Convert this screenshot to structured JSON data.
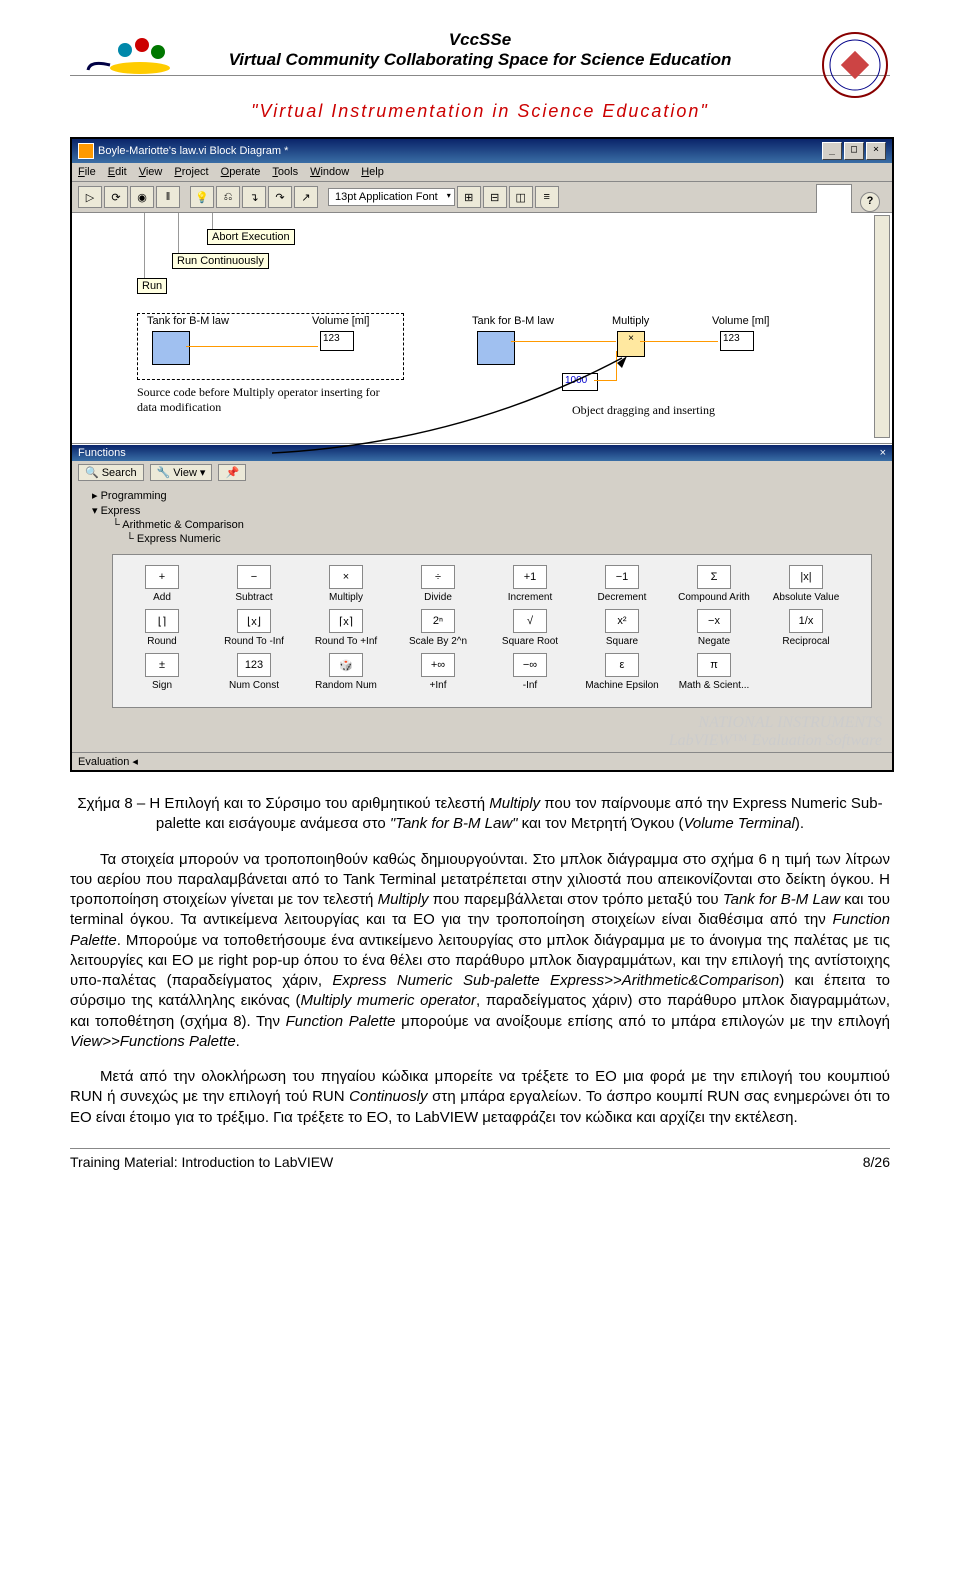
{
  "header": {
    "title1": "VccSSe",
    "title2": "Virtual Community Collaborating Space for Science Education",
    "subtitle": "\"Virtual Instrumentation in Science Education\""
  },
  "window": {
    "title": "Boyle-Mariotte's law.vi Block Diagram *",
    "menu": [
      "File",
      "Edit",
      "View",
      "Project",
      "Operate",
      "Tools",
      "Window",
      "Help"
    ],
    "font": "13pt Application Font",
    "tooltip_run": "Run",
    "tooltip_run_cont": "Run Continuously",
    "tooltip_abort": "Abort Execution",
    "labels": {
      "tank1": "Tank for B-M law",
      "volume1": "Volume [ml]",
      "tank2": "Tank for B-M law",
      "multiply": "Multiply",
      "volume2": "Volume [ml]",
      "num1": "123",
      "num2": "123",
      "const1000": "1000"
    },
    "caption_left": "Source code before Multiply operator inserting for data modification",
    "caption_right": "Object dragging and inserting"
  },
  "functions": {
    "title": "Functions",
    "search": "Search",
    "view": "View",
    "tree": {
      "programming": "Programming",
      "express": "Express",
      "arith": "Arithmetic & Comparison",
      "expnum": "Express Numeric"
    },
    "palette": [
      [
        "Add",
        "Subtract",
        "Multiply",
        "Divide",
        "Increment",
        "Decrement",
        "Compound Arith",
        "Absolute Value"
      ],
      [
        "Round",
        "Round To -Inf",
        "Round To +Inf",
        "Scale By 2^n",
        "Square Root",
        "Square",
        "Negate",
        "Reciprocal"
      ],
      [
        "Sign",
        "Num Const",
        "Random Num",
        "+Inf",
        "-Inf",
        "Machine Epsilon",
        "Math & Scient...",
        ""
      ]
    ],
    "palette_icons": [
      [
        "+",
        "−",
        "×",
        "÷",
        "+1",
        "−1",
        "Σ",
        "|x|"
      ],
      [
        "⌊⌉",
        "⌊x⌋",
        "⌈x⌉",
        "2ⁿ",
        "√",
        "x²",
        "−x",
        "1/x"
      ],
      [
        "±",
        "123",
        "🎲",
        "+∞",
        "−∞",
        "ε",
        "π",
        ""
      ]
    ]
  },
  "watermark1": "NATIONAL INSTRUMENTS",
  "watermark2": "LabVIEW™ Evaluation Software",
  "statusbar": "Evaluation",
  "body": {
    "caption": "Σχήμα 8 – Η Επιλογή και το Σύρσιμο  του αριθμητικού τελεστή ",
    "caption_it1": "Multiply",
    "caption2": " που τον παίρνουμε από την Express Numeric Sub-palette και εισάγουμε  ανάμεσα στο ",
    "caption_it2": "\"Tank for B-M Law\"",
    "caption3": " και τον Μετρητή Όγκου (",
    "caption_it3": "Volume Terminal",
    "caption4": ").",
    "p2a": "Τα στοιχεία μπορούν να τροποποιηθούν καθώς δημιουργούνται. Στο μπλοκ διάγραμμα  στο σχήμα 6 η τιμή  των λίτρων του αερίου που παραλαμβάνεται από το  Tank Terminal μετατρέπεται στην χιλιοστά που απεικονίζονται στο δείκτη όγκου. Η τροποποίηση στοιχείων γίνεται με τον τελεστή  ",
    "p2it1": "Multiply",
    "p2b": "  που παρεμβάλλεται στον τρόπο μεταξύ  του ",
    "p2it2": "Tank for B-M Law",
    "p2c": "   και του   terminal όγκου. Τα αντικείμενα λειτουργίας και τα EO για την τροποποίηση στοιχείων είναι διαθέσιμα από την  ",
    "p2it3": "Function Palette",
    "p2d": ".  Μπορούμε να τοποθετήσουμε ένα αντικείμενο λειτουργίας στο μπλοκ διάγραμμα  με το άνοιγμα της παλέτας με τις λειτουργίες και EO  με right pop-up όπου το ένα θέλει στο παράθυρο μπλοκ διαγραμμάτων, και την επιλογή της αντίστοιχης υπο-παλέτας (παραδείγματος χάριν, ",
    "p2it4": "Express Numeric Sub-palette Express>>Arithmetic&Comparison",
    "p2e": ") και έπειτα το σύρσιμο της κατάλληλης εικόνας (",
    "p2it5": "Multiply mumeric operator",
    "p2f": ", παραδείγματος χάριν) στο παράθυρο μπλοκ διαγραμμάτων, και τοποθέτηση (σχήμα 8). Την  ",
    "p2it6": "Function Palette",
    "p2g": "  μπορούμε να ανοίξουμε επίσης από το μπάρα επιλογών με την επιλογή  ",
    "p2it7": "View>>Functions Palette",
    "p2h": ".",
    "p3a": "Μετά από την ολοκλήρωση του πηγαίου κώδικα μπορείτε να τρέξετε το EO μια φορά με την επιλογή του κουμπιού RUN ή συνεχώς με την επιλογή  τού RUN ",
    "p3it1": "Continuosly",
    "p3b": " στη μπάρα εργαλείων. Το άσπρο  κουμπί  RUN σας ενημερώνει ότι το EO είναι έτοιμο για το τρέξιμο. Για τρέξετε το EO, το  LabVIEW μεταφράζει τον κώδικα  και αρχίζει την εκτέλεση."
  },
  "footer": {
    "left": "Training Material: Introduction to LabVIEW",
    "right": "8/26"
  }
}
